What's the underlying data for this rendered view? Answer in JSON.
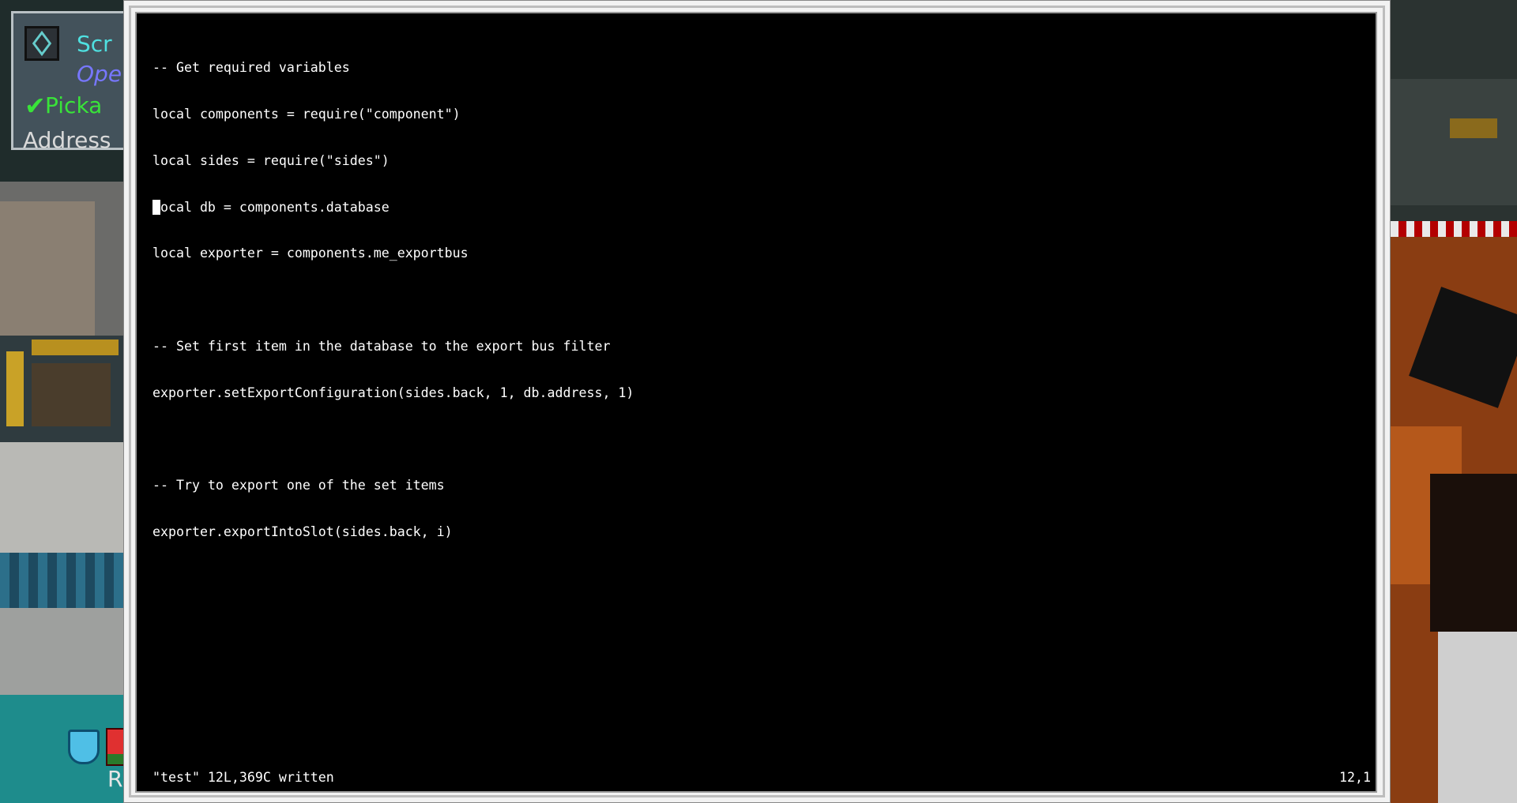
{
  "hud": {
    "icon": "cube-icon",
    "line1": "Scr",
    "line2": "Ope",
    "line3": "Picka",
    "line4": "Address"
  },
  "hotbar": {
    "letter": "R"
  },
  "editor": {
    "lines": [
      "-- Get required variables",
      "local components = require(\"component\")",
      "local sides = require(\"sides\")",
      "local db = components.database",
      "local exporter = components.me_exportbus",
      "",
      "-- Set first item in the database to the export bus filter",
      "exporter.setExportConfiguration(sides.back, 1, db.address, 1)",
      "",
      "-- Try to export one of the set items",
      "exporter.exportIntoSlot(sides.back, i)"
    ],
    "status_message": "\"test\" 12L,369C written",
    "cursor_position": "12,1"
  },
  "colors": {
    "terminal_bg": "#000000",
    "terminal_fg": "#ffffff",
    "frame": "#f2f2f2"
  }
}
